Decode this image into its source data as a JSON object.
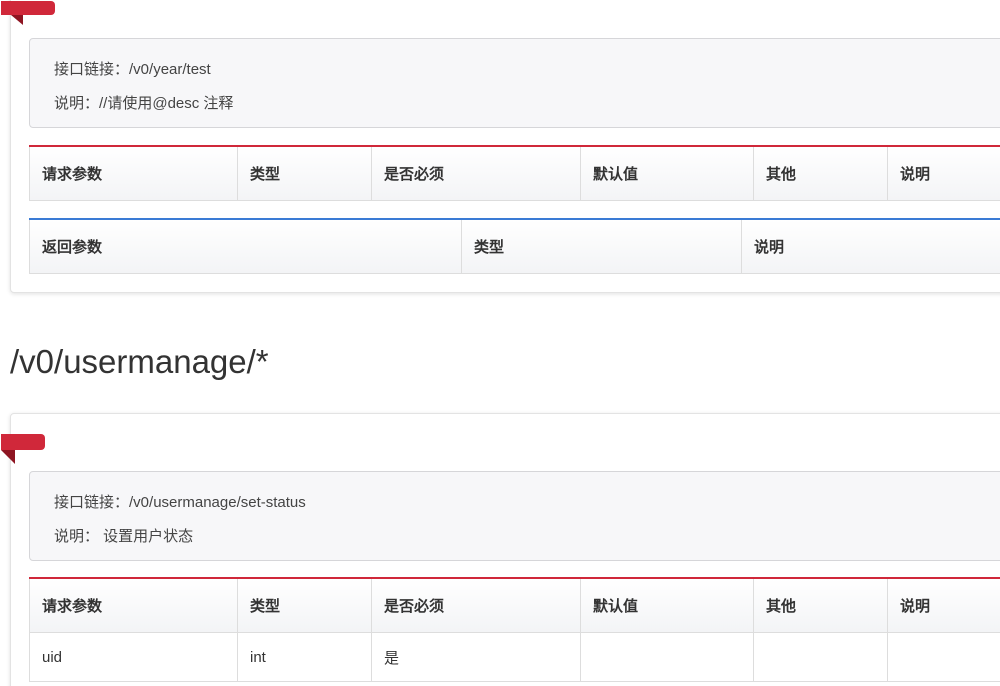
{
  "section1": {
    "info": {
      "link_label": "接口链接：",
      "link_value": "/v0/year/test",
      "desc_label": "说明：",
      "desc_value": "//请使用@desc 注释"
    },
    "request_headers": [
      "请求参数",
      "类型",
      "是否必须",
      "默认值",
      "其他",
      "说明"
    ],
    "response_headers": [
      "返回参数",
      "类型",
      "说明"
    ]
  },
  "section2": {
    "title": "/v0/usermanage/*",
    "info": {
      "link_label": "接口链接：",
      "link_value": "/v0/usermanage/set-status",
      "desc_label": "说明：",
      "desc_value": " 设置用户状态"
    },
    "request_headers": [
      "请求参数",
      "类型",
      "是否必须",
      "默认值",
      "其他",
      "说明"
    ],
    "rows": [
      [
        "uid",
        "int",
        "是",
        "",
        "",
        ""
      ]
    ]
  },
  "colors": {
    "accent_red": "#d0283a",
    "accent_blue": "#3a7bd5"
  }
}
